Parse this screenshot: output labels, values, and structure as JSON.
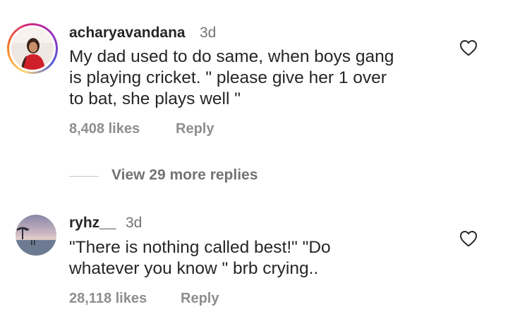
{
  "comments": [
    {
      "username": "acharyavandana",
      "age": "3d",
      "text_lines": [
        "My dad used to do same, when boys gang",
        "is playing cricket. \" please give her 1 over",
        "to bat, she plays well \""
      ],
      "likes": "8,408 likes",
      "reply_label": "Reply",
      "has_story_ring": true
    },
    {
      "username": "ryhz__",
      "age": "3d",
      "text_lines": [
        "\"There is nothing called best!\" \"Do",
        "whatever you know \" brb crying.."
      ],
      "likes": "28,118 likes",
      "reply_label": "Reply",
      "has_story_ring": false
    }
  ],
  "view_replies_label": "View 29 more replies",
  "icons": {
    "like": "heart-outline-icon"
  },
  "colors": {
    "text": "#262626",
    "muted": "#8e8e8e",
    "story_ring": "#d62976"
  }
}
